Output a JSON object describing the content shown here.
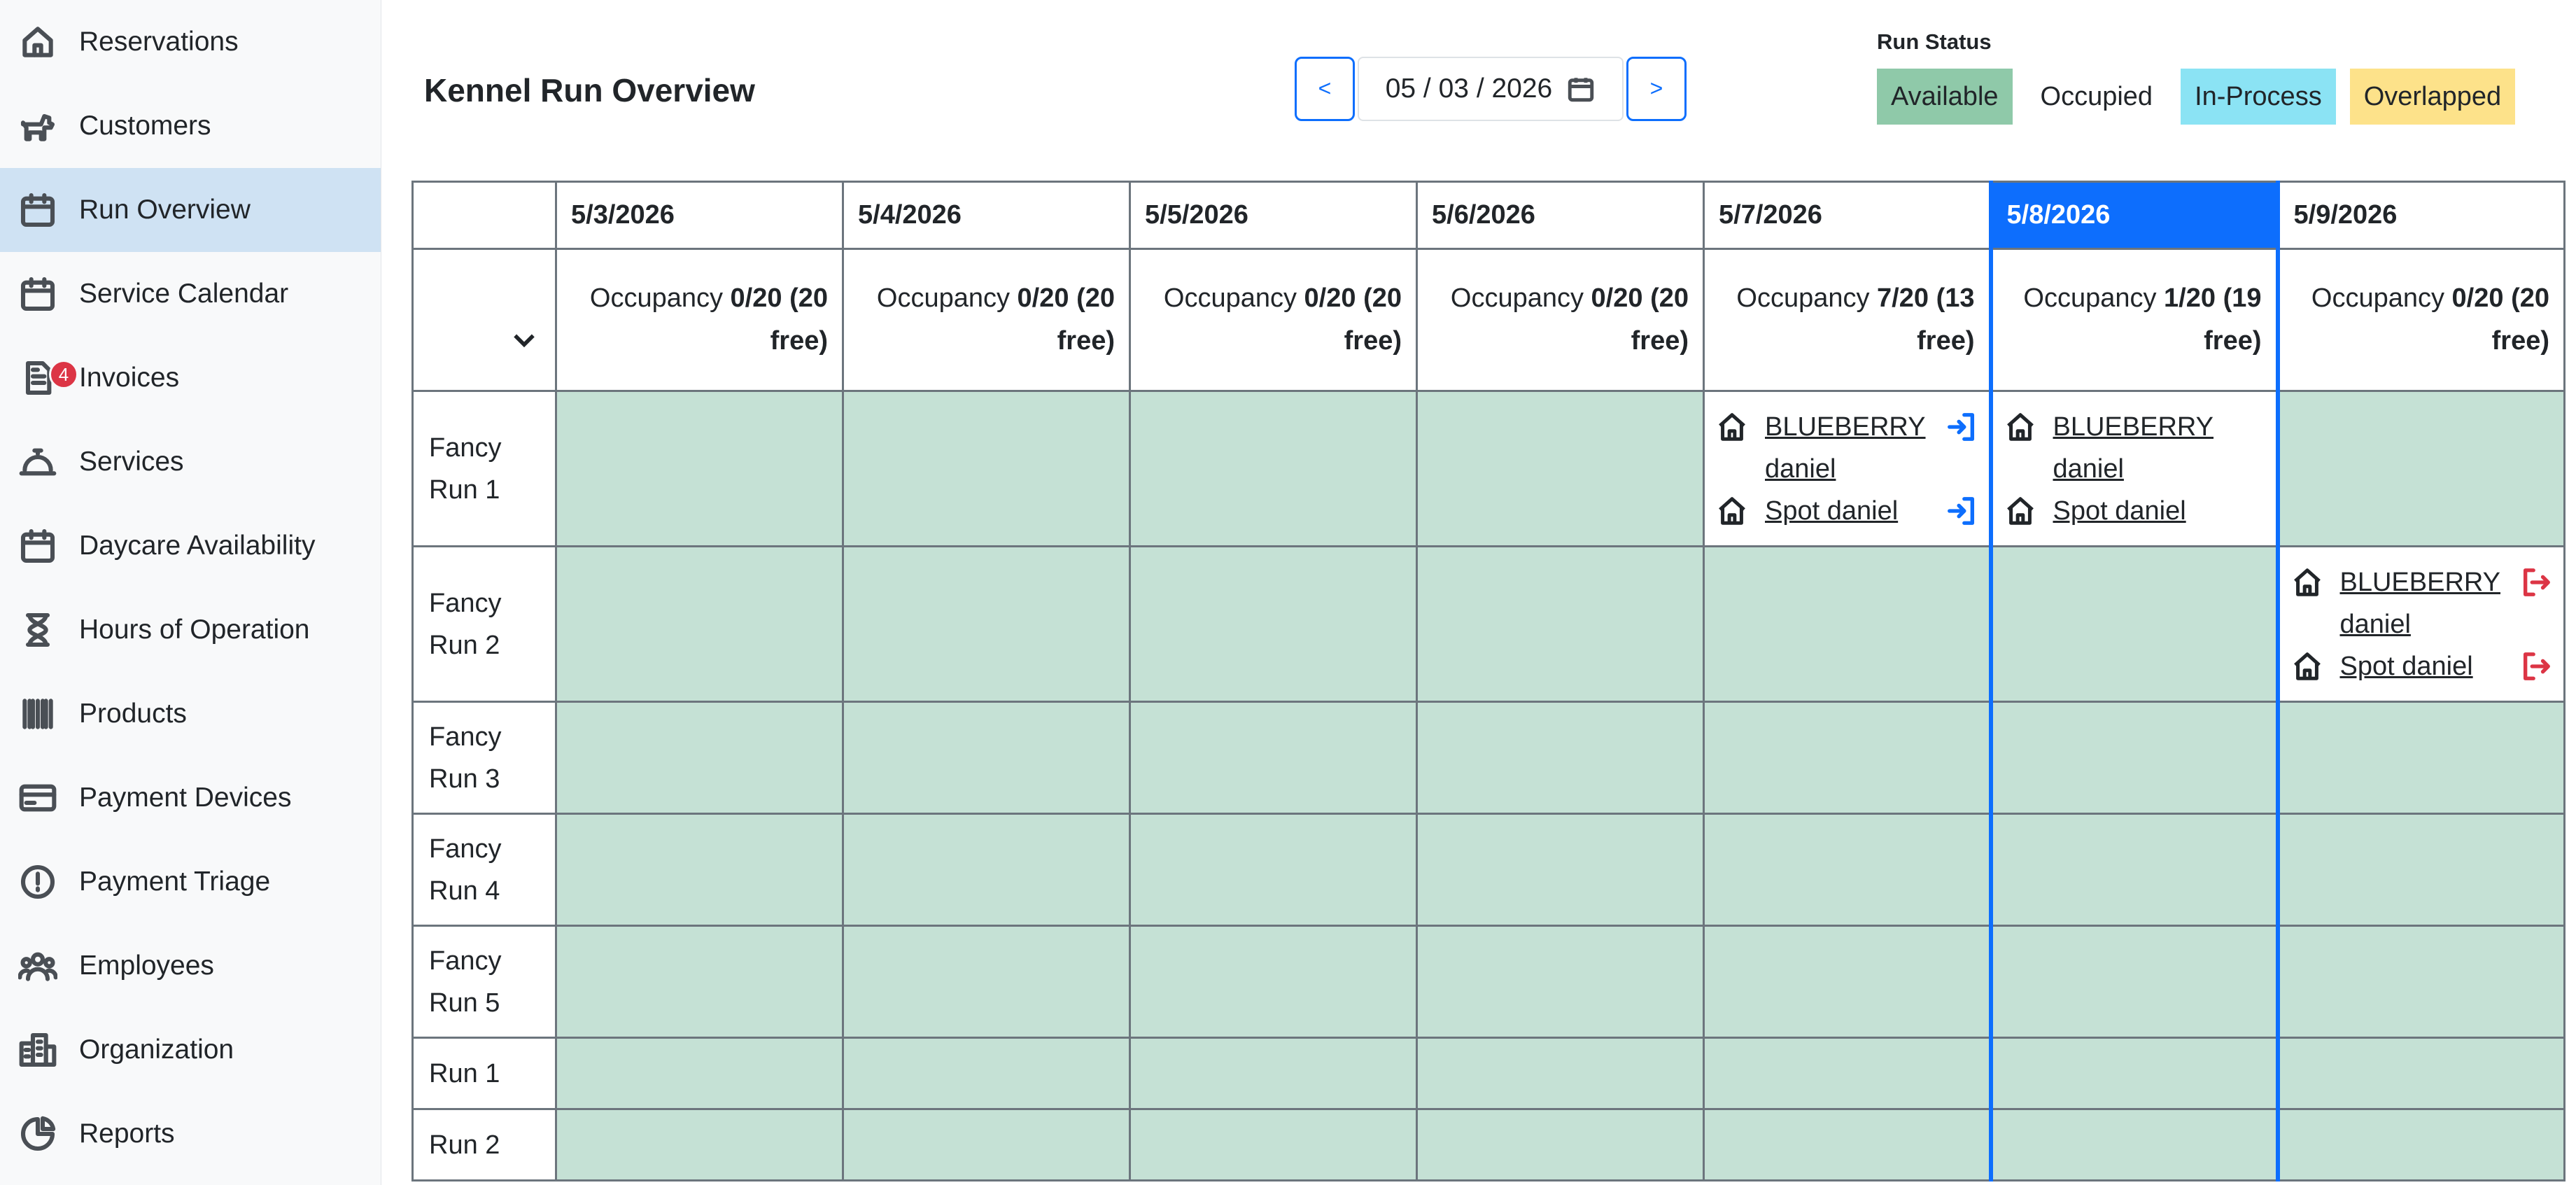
{
  "sidebar": {
    "items": [
      {
        "label": "Reservations",
        "icon": "house-icon"
      },
      {
        "label": "Customers",
        "icon": "dog-icon"
      },
      {
        "label": "Run Overview",
        "icon": "calendar-icon",
        "active": true
      },
      {
        "label": "Service Calendar",
        "icon": "calendar-icon"
      },
      {
        "label": "Invoices",
        "icon": "invoice-icon",
        "badge": "4"
      },
      {
        "label": "Services",
        "icon": "service-bell-icon"
      },
      {
        "label": "Daycare Availability",
        "icon": "calendar-icon"
      },
      {
        "label": "Hours of Operation",
        "icon": "hourglass-icon"
      },
      {
        "label": "Products",
        "icon": "barcode-icon"
      },
      {
        "label": "Payment Devices",
        "icon": "credit-card-icon"
      },
      {
        "label": "Payment Triage",
        "icon": "alert-circle-icon"
      },
      {
        "label": "Employees",
        "icon": "people-icon"
      },
      {
        "label": "Organization",
        "icon": "buildings-icon"
      },
      {
        "label": "Reports",
        "icon": "pie-chart-icon"
      }
    ]
  },
  "header": {
    "title": "Kennel Run Overview",
    "prev_label": "<",
    "next_label": ">",
    "date_value": "05 / 03 / 2026"
  },
  "legend": {
    "title": "Run Status",
    "items": [
      {
        "label": "Available",
        "color": "#8fc9a9"
      },
      {
        "label": "Occupied",
        "color": "#ffffff"
      },
      {
        "label": "In-Process",
        "color": "#8be3f4"
      },
      {
        "label": "Overlapped",
        "color": "#fde28a"
      }
    ]
  },
  "grid": {
    "dates": [
      "5/3/2026",
      "5/4/2026",
      "5/5/2026",
      "5/6/2026",
      "5/7/2026",
      "5/8/2026",
      "5/9/2026"
    ],
    "highlighted_index": 5,
    "occupancy_label": "Occupancy",
    "occupancy": [
      "0/20 (20 free)",
      "0/20 (20 free)",
      "0/20 (20 free)",
      "0/20 (20 free)",
      "7/20 (13 free)",
      "1/20 (19 free)",
      "0/20 (20 free)"
    ],
    "runs": [
      "Fancy Run 1",
      "Fancy Run 2",
      "Fancy Run 3",
      "Fancy Run 4",
      "Fancy Run 5",
      "Run 1",
      "Run 2"
    ],
    "reservations": {
      "r0c4": [
        {
          "pet": "BLUEBERRY daniel",
          "action": "check-in"
        },
        {
          "pet": "Spot daniel",
          "action": "check-in"
        }
      ],
      "r0c5": [
        {
          "pet": "BLUEBERRY daniel",
          "action": ""
        },
        {
          "pet": "Spot daniel",
          "action": ""
        }
      ],
      "r1c6": [
        {
          "pet": "BLUEBERRY daniel",
          "action": "check-out"
        },
        {
          "pet": "Spot daniel",
          "action": "check-out"
        }
      ]
    },
    "colors": {
      "available": "#c5e1d5",
      "today": "#0d6efd",
      "checkin": "#0d6efd",
      "checkout": "#dc3545"
    }
  }
}
